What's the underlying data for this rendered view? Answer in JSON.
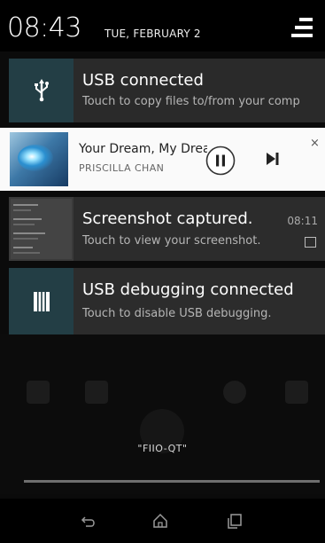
{
  "status_bar": {
    "time": "08:43",
    "date": "TUE, FEBRUARY 2",
    "quick_settings_icon": "quick-settings-icon"
  },
  "notifications": [
    {
      "id": "usb",
      "icon": "usb-icon",
      "title": "USB connected",
      "subtitle": "Touch to copy files to/from your comp"
    },
    {
      "id": "media",
      "title": "Your Dream, My Drea",
      "artist": "PRISCILLA CHAN",
      "icons": [
        "album-art",
        "pause-icon",
        "skip-next-icon"
      ],
      "close_label": "×"
    },
    {
      "id": "screenshot",
      "title": "Screenshot captured.",
      "subtitle": "Touch to view your screenshot.",
      "time": "08:11",
      "icon": "image-icon"
    },
    {
      "id": "usb-debug",
      "icon": "usb-debugging-icon",
      "title": "USB debugging connected",
      "subtitle": "Touch to disable USB debugging."
    }
  ],
  "background_player": {
    "device_name": "\"FIIO-QT\""
  },
  "nav_bar": {
    "icons": [
      "back-icon",
      "home-icon",
      "recents-icon"
    ]
  },
  "colors": {
    "notification_bg": "#2a2a2a",
    "icon_bg": "#233e45",
    "media_bg": "#fafafa"
  }
}
